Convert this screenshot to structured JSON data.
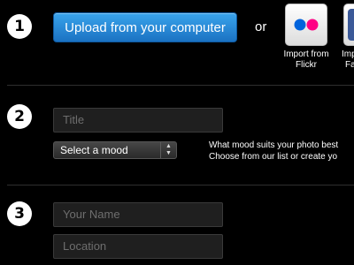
{
  "steps": {
    "one": "1",
    "two": "2",
    "three": "3"
  },
  "upload": {
    "button_label": "Upload from your computer",
    "or_label": "or"
  },
  "imports": {
    "flickr_label_line1": "Import from",
    "flickr_label_line2": "Flickr",
    "facebook_label_line1": "Import",
    "facebook_label_line2": "Fa"
  },
  "details": {
    "title_placeholder": "Title",
    "mood_selected": "Select a mood",
    "mood_hint_line1": "What mood suits your photo best",
    "mood_hint_line2": "Choose from our list or create yo"
  },
  "contact": {
    "name_placeholder": "Your Name",
    "location_placeholder": "Location"
  },
  "colors": {
    "upload_button": "#2a8ad8",
    "flickr_blue": "#0063dc",
    "flickr_pink": "#ff0084",
    "facebook_blue": "#3b5998"
  }
}
